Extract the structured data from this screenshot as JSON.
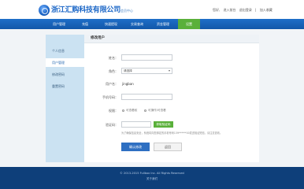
{
  "brand": {
    "name": "浙江汇购科技有限公司",
    "sub": "会员中心"
  },
  "top_links": [
    "您好,",
    "进入前台",
    "退出登录",
    "|",
    "加入收藏"
  ],
  "nav": {
    "items": [
      "用户管理",
      "充值",
      "快速提现",
      "交易查询",
      "资金管理",
      "设置"
    ],
    "active_index": 5
  },
  "sidebar": {
    "items": [
      "个人信息",
      "用户管理",
      "修改密码",
      "重置密码"
    ],
    "active_index": 1
  },
  "panel": {
    "title": "修改用户"
  },
  "form": {
    "name_label": "姓名：",
    "name_value": "",
    "role_label": "角色：",
    "role_value": "请选择",
    "username_label": "用户名：",
    "username_value": "jingban",
    "phone_label": "手机号码：",
    "phone_value": "",
    "perm_label": "权限：",
    "perm_option1": "可查看权",
    "perm_option2": "可操作/可查看",
    "code_label": "验证码：",
    "code_value": "",
    "code_button": "获取验证码",
    "hint": "为了确保信息安全，系统将向您绑定的手机号码139******00发送验证短信，请注意查收。",
    "submit": "确认修改",
    "back": "返回"
  },
  "footer": {
    "copyright": "© 2013-2015 Fullbox Inc. All Rights Reserved",
    "link": "关于我们"
  },
  "colors": {
    "brand_blue": "#1c67c7",
    "nav_blue": "#1f6fc8",
    "active_green": "#5ab03a",
    "footer_navy": "#0e3f7a"
  }
}
